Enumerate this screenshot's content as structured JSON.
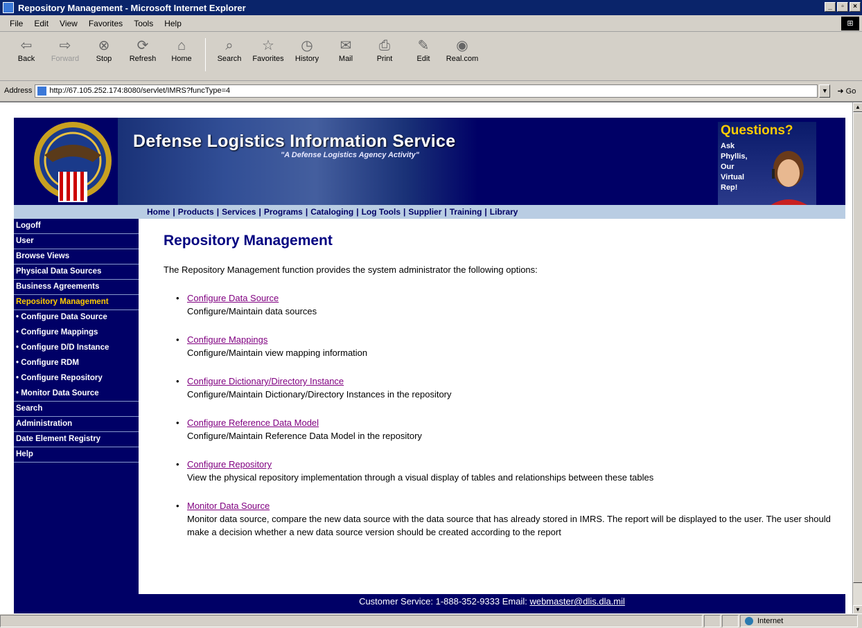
{
  "window": {
    "title": "Repository Management - Microsoft Internet Explorer",
    "min_glyph": "_",
    "max_glyph": "▫",
    "close_glyph": "×"
  },
  "menu": [
    "File",
    "Edit",
    "View",
    "Favorites",
    "Tools",
    "Help"
  ],
  "toolbar": {
    "back": "Back",
    "forward": "Forward",
    "stop": "Stop",
    "refresh": "Refresh",
    "home": "Home",
    "search": "Search",
    "favorites": "Favorites",
    "history": "History",
    "mail": "Mail",
    "print": "Print",
    "edit": "Edit",
    "real": "Real.com"
  },
  "address": {
    "label": "Address",
    "url": "http://67.105.252.174:8080/servlet/IMRS?funcType=4",
    "go": "Go"
  },
  "banner": {
    "title": "Defense Logistics Information Service",
    "subtitle": "\"A Defense Logistics Agency Activity\"",
    "questions_title": "Questions?",
    "questions_text": "Ask\nPhyllis,\nOur\nVirtual\nRep!"
  },
  "topnav": [
    "Home",
    "Products",
    "Services",
    "Programs",
    "Cataloging",
    "Log Tools",
    "Supplier",
    "Training",
    "Library"
  ],
  "sidebar": [
    {
      "label": "Logoff",
      "kind": "top"
    },
    {
      "label": "User",
      "kind": "top"
    },
    {
      "label": "Browse Views",
      "kind": "top"
    },
    {
      "label": "Physical Data Sources",
      "kind": "top"
    },
    {
      "label": "Business Agreements",
      "kind": "top"
    },
    {
      "label": "Repository Management",
      "kind": "active"
    },
    {
      "label": "• Configure Data Source",
      "kind": "sub"
    },
    {
      "label": "• Configure Mappings",
      "kind": "sub"
    },
    {
      "label": "• Configure D/D Instance",
      "kind": "sub"
    },
    {
      "label": "• Configure RDM",
      "kind": "sub"
    },
    {
      "label": "• Configure Repository",
      "kind": "sub"
    },
    {
      "label": "• Monitor Data Source",
      "kind": "sub-last"
    },
    {
      "label": "Search",
      "kind": "top"
    },
    {
      "label": "Administration",
      "kind": "top"
    },
    {
      "label": "Date Element Registry",
      "kind": "top"
    },
    {
      "label": "Help",
      "kind": "top"
    }
  ],
  "main": {
    "title": "Repository Management",
    "intro": "The Repository Management function provides the system administrator the following options:",
    "options": [
      {
        "link": "Configure Data Source",
        "desc": "Configure/Maintain data sources"
      },
      {
        "link": "Configure Mappings",
        "desc": "Configure/Maintain view mapping information"
      },
      {
        "link": "Configure Dictionary/Directory Instance",
        "desc": "Configure/Maintain Dictionary/Directory Instances in the repository"
      },
      {
        "link": "Configure Reference Data Model",
        "desc": "Configure/Maintain Reference Data Model in the repository"
      },
      {
        "link": "Configure Repository",
        "desc": "View the physical repository implementation through a visual display of tables and relationships between these tables"
      },
      {
        "link": "Monitor Data Source",
        "desc": "Monitor data source, compare the new data source with the data source that has already stored in IMRS. The report will be displayed to the user. The user should make a decision whether a new data source version should be created according to the report"
      }
    ]
  },
  "footer": {
    "text": "Customer Service: 1-888-352-9333 Email: ",
    "email": "webmaster@dlis.dla.mil"
  },
  "status": {
    "zone": "Internet"
  },
  "colors": {
    "navy": "#000066",
    "active": "#ffcc00",
    "link_visited": "#800080",
    "nav_bar": "#b9cde3"
  }
}
